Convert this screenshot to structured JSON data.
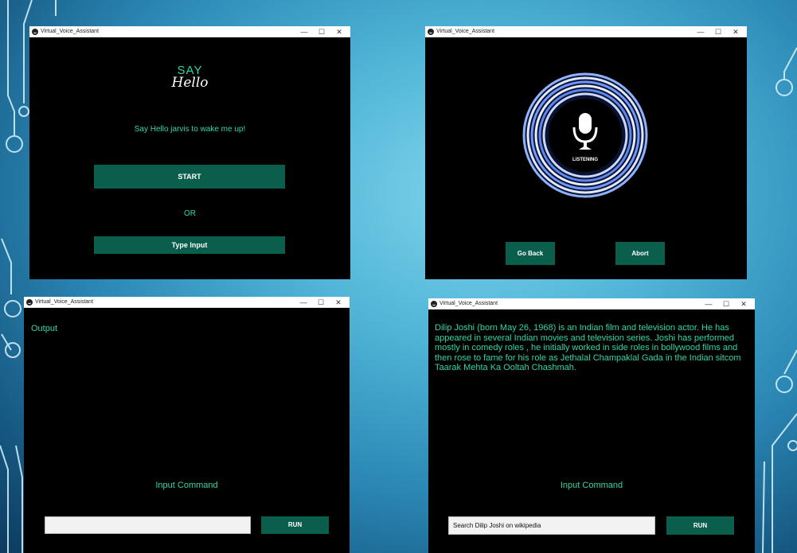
{
  "windows": {
    "w1": {
      "title": "Virtual_Voice_Assistant",
      "controls": {
        "minimize": "—",
        "maximize": "☐",
        "close": "✕"
      },
      "logo": {
        "say": "SAY",
        "hello": "Hello"
      },
      "wake_text": "Say Hello jarvis to wake me up!",
      "start_label": "START",
      "or_label": "OR",
      "type_input_label": "Type Input"
    },
    "w2": {
      "title": "Virtual_Voice_Assistant",
      "controls": {
        "minimize": "—",
        "maximize": "☐",
        "close": "✕"
      },
      "status": "LISTENING",
      "go_back_label": "Go Back",
      "abort_label": "Abort"
    },
    "w3": {
      "title": "Virtual_Voice_Assistant",
      "controls": {
        "minimize": "—",
        "maximize": "☐",
        "close": "✕"
      },
      "output_label": "Output",
      "input_command_label": "Input Command",
      "input_value": "",
      "run_label": "RUN"
    },
    "w4": {
      "title": "Virtual_Voice_Assistant",
      "controls": {
        "minimize": "—",
        "maximize": "☐",
        "close": "✕"
      },
      "result_text": "Dilip Joshi (born May 26, 1968) is an Indian film and television actor. He has appeared in several Indian movies and television series. Joshi has performed mostly in comedy roles , he initially worked in side roles  in bollywood films and then rose to fame  for his role as Jethalal Champaklal Gada in the Indian sitcom Taarak Mehta Ka Ooltah Chashmah.",
      "input_command_label": "Input Command",
      "input_value": "Search Dilip Joshi on wikipedia",
      "run_label": "RUN"
    }
  },
  "colors": {
    "accent_text": "#2fd6a8",
    "button_bg": "#0a5e4c",
    "window_bg": "#000000"
  }
}
